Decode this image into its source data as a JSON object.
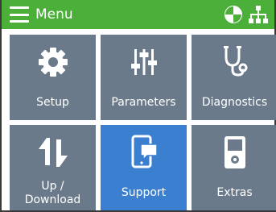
{
  "header": {
    "menu_label": "Menu",
    "icons": [
      "hamburger-menu-icon",
      "quarter-circle-status-icon",
      "network-tree-icon"
    ],
    "background": "#4caf3a"
  },
  "tiles": [
    {
      "label": "Setup",
      "icon": "gear-icon",
      "active": false
    },
    {
      "label": "Parameters",
      "icon": "sliders-icon",
      "active": false
    },
    {
      "label": "Diagnostics",
      "icon": "stethoscope-icon",
      "active": false
    },
    {
      "label": "Up /\nDownload",
      "icon": "up-down-arrows-icon",
      "active": false
    },
    {
      "label": "Support",
      "icon": "tablet-chat-icon",
      "active": true
    },
    {
      "label": "Extras",
      "icon": "device-icon",
      "active": false
    }
  ],
  "colors": {
    "tile": "#6b7a8a",
    "tile_active": "#3a7fd0",
    "frame": "#3a3a3a"
  }
}
